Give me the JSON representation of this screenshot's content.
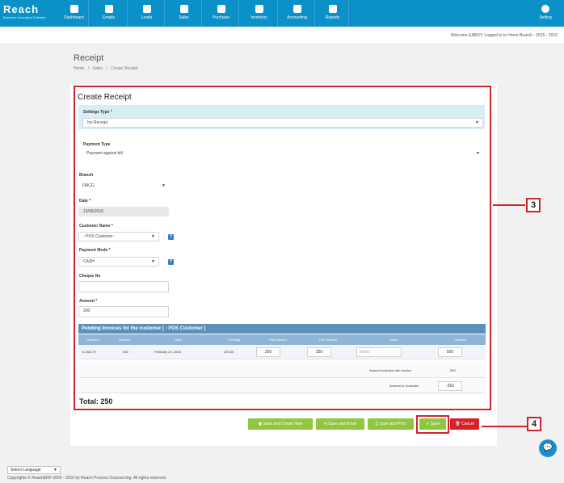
{
  "logo": {
    "name": "Reach",
    "tagline": "Business Innovation Software"
  },
  "nav": [
    {
      "label": "Dashboard",
      "icon": "dashboard-icon"
    },
    {
      "label": "Emails",
      "icon": "email-icon"
    },
    {
      "label": "Leads",
      "icon": "leads-icon"
    },
    {
      "label": "Sales",
      "icon": "sales-icon"
    },
    {
      "label": "Purchase",
      "icon": "purchase-icon"
    },
    {
      "label": "Inventory",
      "icon": "inventory-icon"
    },
    {
      "label": "Accounting",
      "icon": "accounting-icon"
    },
    {
      "label": "Reports",
      "icon": "reports-icon"
    },
    {
      "label": "Setting",
      "icon": "gear-icon"
    }
  ],
  "welcome": "Welcome EABOY, Logged in to Home Branch - 2015 - 2016",
  "page": {
    "title": "Receipt",
    "breadcrumb": [
      "Home",
      "/",
      "Sales",
      "/",
      "Create Receipt"
    ]
  },
  "form": {
    "title": "Create Receipt",
    "settings_type_label": "Settings Type *",
    "settings_type_value": "Inv Receipt",
    "payment_type_label": "Payment Type",
    "payment_type_value": "Payment against bill",
    "branch_label": "Branch",
    "branch_value": "FMCG",
    "date_label": "Date *",
    "date_value": "13/06/2016",
    "customer_label": "Customer Name *",
    "customer_value": "- POS Customer -",
    "payment_mode_label": "Payment Mode *",
    "payment_mode_value": "CASH",
    "cheque_label": "Cheque No",
    "cheque_value": "",
    "amount_label": "Amount *",
    "amount_value": "250"
  },
  "invoices": {
    "header": "Pending Invoices for the customer [ - POS Customer ]",
    "columns": [
      "Invoice #",
      "Amount",
      "Date",
      "Pending",
      "Pay Amount",
      "TDS Amount",
      "Notes",
      "Amount"
    ],
    "row": {
      "invoice": "A 1601 R",
      "amount": "500",
      "date": "February 23, 2016",
      "pending": "220.00",
      "pay_amount": "250",
      "tds_amount": "250",
      "notes_placeholder": "Notes"
    },
    "matched_label": "Amount matched with Invoice",
    "matched_value": "500",
    "to_customer_label": "Amount to Customer",
    "to_customer_value": "-250"
  },
  "total": "Total: 250",
  "buttons": {
    "save_create_new": "Save and Create New",
    "save_email": "Save and Email",
    "save_print": "Save and Print",
    "save": "Save",
    "cancel": "Cancel"
  },
  "callouts": {
    "three": "3",
    "four": "4"
  },
  "footer": {
    "language": "Select Language",
    "copyright": "Copyrights © ReachERP 2000 - 2016 by Reach Process Outsourcing. All rights reserved."
  },
  "colors": {
    "nav": "#0b90c8",
    "highlight": "#d9edf7",
    "green": "#8fc73e",
    "red": "#d5202a",
    "callout": "#d0242b"
  }
}
